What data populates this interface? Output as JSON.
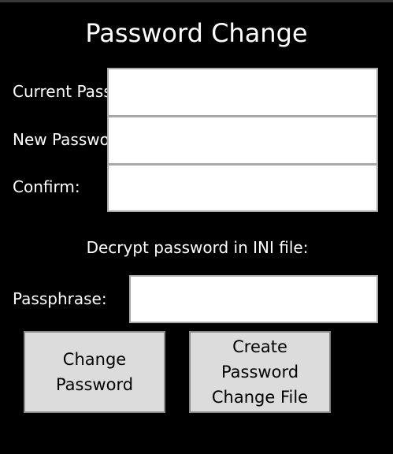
{
  "window": {
    "title": "Password Change"
  },
  "fields": {
    "current_label": "Current Password:",
    "current_value": "",
    "new_label": "New Password:",
    "new_value": "",
    "confirm_label": "Confirm:",
    "confirm_value": ""
  },
  "ini_section": {
    "heading": "Decrypt password in INI file:",
    "passphrase_label": "Passphrase:",
    "passphrase_value": ""
  },
  "buttons": {
    "change_password": "Change\nPassword",
    "create_file": "Create\nPassword\nChange File"
  }
}
